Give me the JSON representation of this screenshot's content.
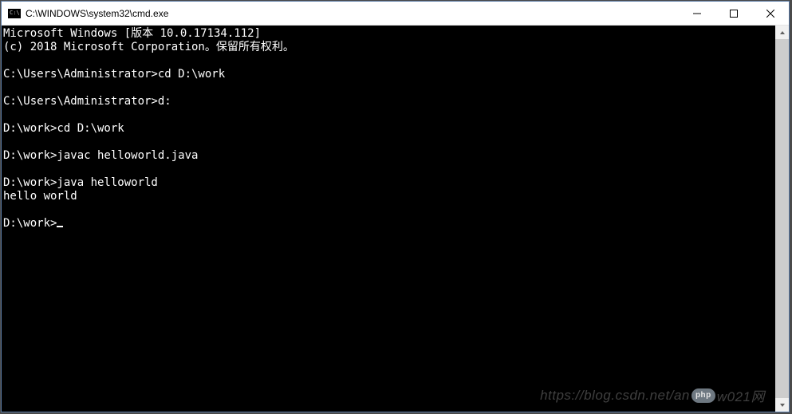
{
  "titlebar": {
    "icon_text": "C:\\",
    "title": "C:\\WINDOWS\\system32\\cmd.exe"
  },
  "terminal": {
    "lines": [
      "Microsoft Windows [版本 10.0.17134.112]",
      "(c) 2018 Microsoft Corporation。保留所有权利。",
      "",
      "C:\\Users\\Administrator>cd D:\\work",
      "",
      "C:\\Users\\Administrator>d:",
      "",
      "D:\\work>cd D:\\work",
      "",
      "D:\\work>javac helloworld.java",
      "",
      "D:\\work>java helloworld",
      "hello world",
      "",
      "D:\\work>"
    ]
  },
  "watermark": {
    "text_left": "https://blog.csdn.net/an",
    "badge": "php",
    "text_right": "w021网"
  }
}
